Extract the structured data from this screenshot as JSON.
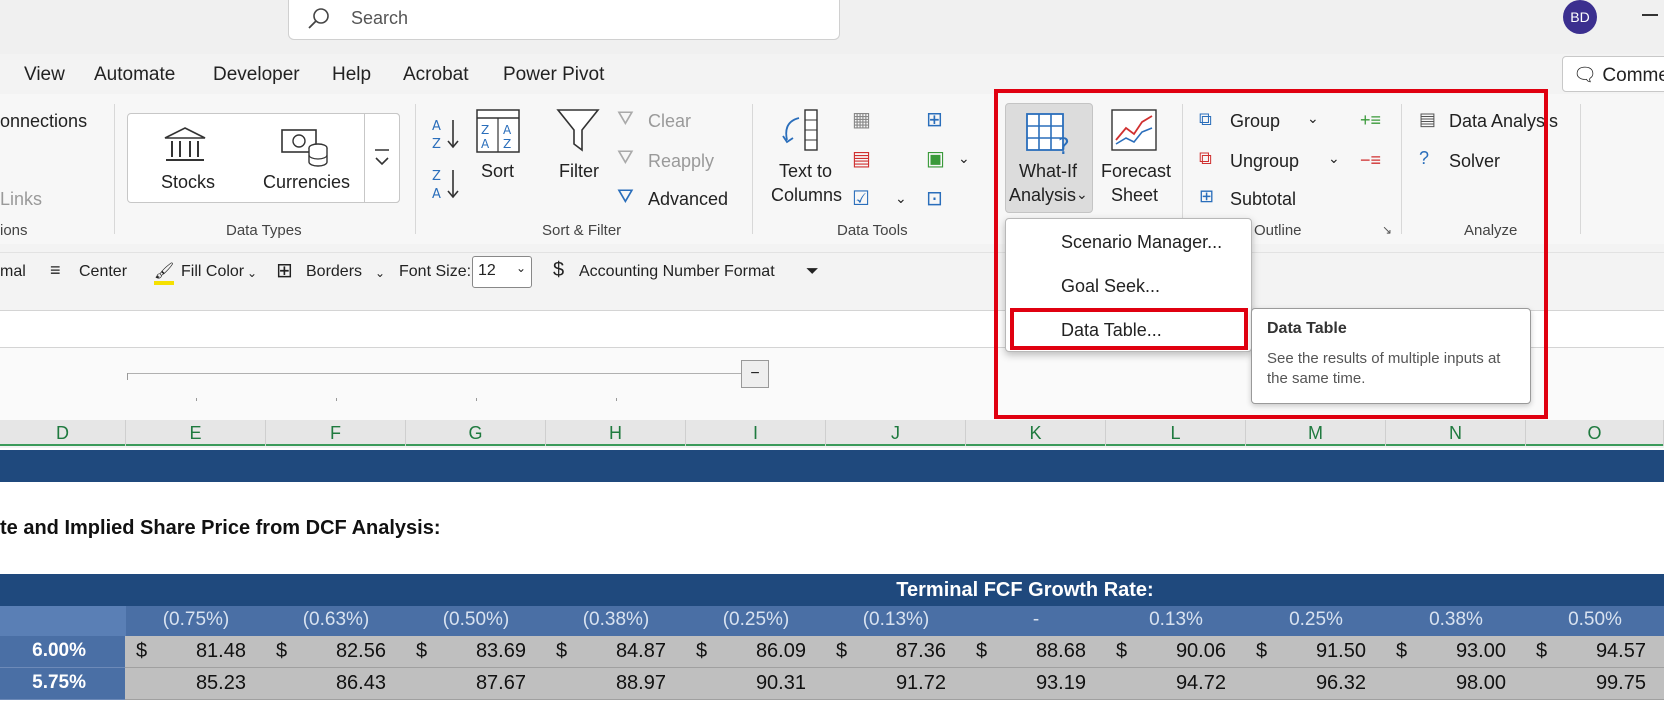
{
  "titlebar": {
    "search_placeholder": "Search",
    "avatar_initials": "BD"
  },
  "menu_tabs": [
    "View",
    "Automate",
    "Developer",
    "Help",
    "Acrobat",
    "Power Pivot"
  ],
  "comments_label": "Comments",
  "ribbon": {
    "queries": {
      "connections": "onnections",
      "links": "Links",
      "group_label": "ions"
    },
    "data_types": {
      "stocks": "Stocks",
      "currencies": "Currencies",
      "group_label": "Data Types"
    },
    "sort_filter": {
      "sort": "Sort",
      "filter": "Filter",
      "clear": "Clear",
      "reapply": "Reapply",
      "advanced": "Advanced",
      "group_label": "Sort & Filter"
    },
    "data_tools": {
      "text_to_columns_1": "Text to",
      "text_to_columns_2": "Columns",
      "group_label": "Data Tools"
    },
    "forecast": {
      "whatif_1": "What-If",
      "whatif_2": "Analysis",
      "forecast_1": "Forecast",
      "forecast_2": "Sheet"
    },
    "outline": {
      "group": "Group",
      "ungroup": "Ungroup",
      "subtotal": "Subtotal",
      "group_label": "Outline"
    },
    "analyze": {
      "data_analysis": "Data Analysis",
      "solver": "Solver",
      "group_label": "Analyze"
    }
  },
  "format_bar": {
    "general": "mal",
    "center": "Center",
    "fill_color": "Fill Color",
    "borders": "Borders",
    "font_size_label": "Font Size:",
    "font_size_value": "12",
    "accounting": "Accounting Number Format"
  },
  "columns": [
    "D",
    "E",
    "F",
    "G",
    "H",
    "I",
    "J",
    "K",
    "L",
    "M",
    "N",
    "O"
  ],
  "sheet": {
    "heading": "te and Implied Share Price from DCF Analysis:",
    "table_title": "Terminal FCF Growth Rate:",
    "growth_rates": [
      "(0.75%)",
      "(0.63%)",
      "(0.50%)",
      "(0.38%)",
      "(0.25%)",
      "(0.13%)",
      "-",
      "0.13%",
      "0.25%",
      "0.38%",
      "0.50%"
    ],
    "rows": [
      {
        "rate": "6.00%",
        "values": [
          "81.48",
          "82.56",
          "83.69",
          "84.87",
          "86.09",
          "87.36",
          "88.68",
          "90.06",
          "91.50",
          "93.00",
          "94.57"
        ]
      },
      {
        "rate": "5.75%",
        "values": [
          "85.23",
          "86.43",
          "87.67",
          "88.97",
          "90.31",
          "91.72",
          "93.19",
          "94.72",
          "96.32",
          "98.00",
          "99.75"
        ]
      }
    ],
    "currency": "$"
  },
  "whatif_menu": {
    "items": [
      "Scenario Manager...",
      "Goal Seek...",
      "Data Table..."
    ]
  },
  "tooltip": {
    "title": "Data Table",
    "description": "See the results of multiple inputs at the same time."
  },
  "colors": {
    "header_blue": "#1f497d",
    "rate_blue": "#4a6fa5",
    "highlight_red": "#e00010",
    "column_green": "#1f7a3f"
  }
}
